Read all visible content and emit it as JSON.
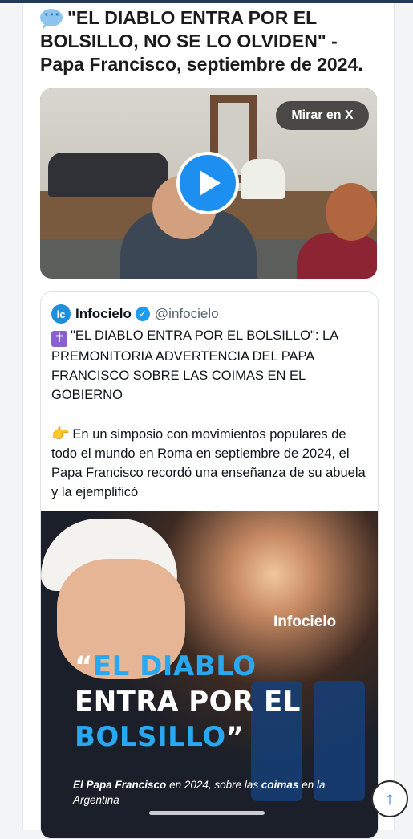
{
  "post": {
    "title": "\"EL DIABLO ENTRA POR EL BOLSILLO, NO SE LO OLVIDEN\" - Papa Francisco, septiembre de 2024.",
    "title_icon": "speech-bubble-icon"
  },
  "video": {
    "watch_label": "Mirar en X",
    "play_icon": "play-icon"
  },
  "quote": {
    "avatar_text": "ic",
    "name": "Infocielo",
    "handle": "@infocielo",
    "verified_icon": "verified-badge-icon",
    "cross_icon": "✝",
    "headline": "\"EL DIABLO ENTRA POR EL BOLSILLO\": LA PREMONITORIA ADVERTENCIA DEL PAPA FRANCISCO SOBRE LAS COIMAS EN EL GOBIERNO",
    "pointing_icon": "👉",
    "body": "En un simposio con movimientos populares de todo el mundo en Roma en septiembre de 2024, el Papa Francisco recordó una enseñanza de su abuela y la ejemplificó"
  },
  "promo": {
    "brand": "Infocielo",
    "quote_open": "“",
    "line1": "EL DIABLO",
    "line2": "ENTRA POR EL",
    "line3": "BOLSILLO",
    "quote_close": "”",
    "caption_1": "El Papa Francisco",
    "caption_2": " en 2024, sobre las ",
    "caption_3": "coimas",
    "caption_4": " en la Argentina"
  },
  "colors": {
    "accent_blue": "#1d9bf0",
    "promo_blue": "#28a8f0",
    "header": "#213a5c"
  },
  "scroll_top_icon": "arrow-up-icon"
}
